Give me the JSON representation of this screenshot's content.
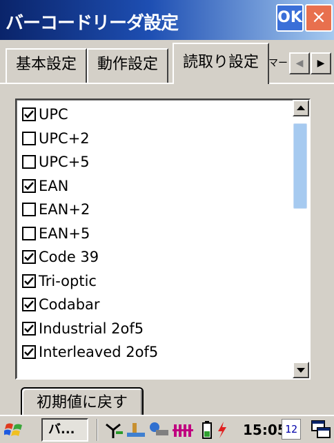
{
  "window": {
    "title": "バーコードリーダ設定",
    "ok_label": "OK",
    "close_label": "×"
  },
  "tabs": [
    {
      "label": "基本設定",
      "active": false
    },
    {
      "label": "動作設定",
      "active": false
    },
    {
      "label": "読取り設定",
      "active": true
    }
  ],
  "tab_overflow_peek": "マー",
  "tab_scroll": {
    "left_icon": "◀",
    "right_icon": "▶"
  },
  "symbologies": [
    {
      "label": "UPC",
      "checked": true
    },
    {
      "label": "UPC+2",
      "checked": false
    },
    {
      "label": "UPC+5",
      "checked": false
    },
    {
      "label": "EAN",
      "checked": true
    },
    {
      "label": "EAN+2",
      "checked": false
    },
    {
      "label": "EAN+5",
      "checked": false
    },
    {
      "label": "Code 39",
      "checked": true
    },
    {
      "label": "Tri-optic",
      "checked": true
    },
    {
      "label": "Codabar",
      "checked": true
    },
    {
      "label": "Industrial 2of5",
      "checked": true
    },
    {
      "label": "Interleaved 2of5",
      "checked": true
    }
  ],
  "reset_button_label": "初期値に戻す",
  "taskbar": {
    "task_label": "バ...",
    "clock": "15:05",
    "calendar_day": "12"
  },
  "colors": {
    "titlebar_start": "#0a246a",
    "titlebar_end": "#a6caf0",
    "scroll_thumb": "#a6caf0",
    "face": "#d4d0c8"
  }
}
